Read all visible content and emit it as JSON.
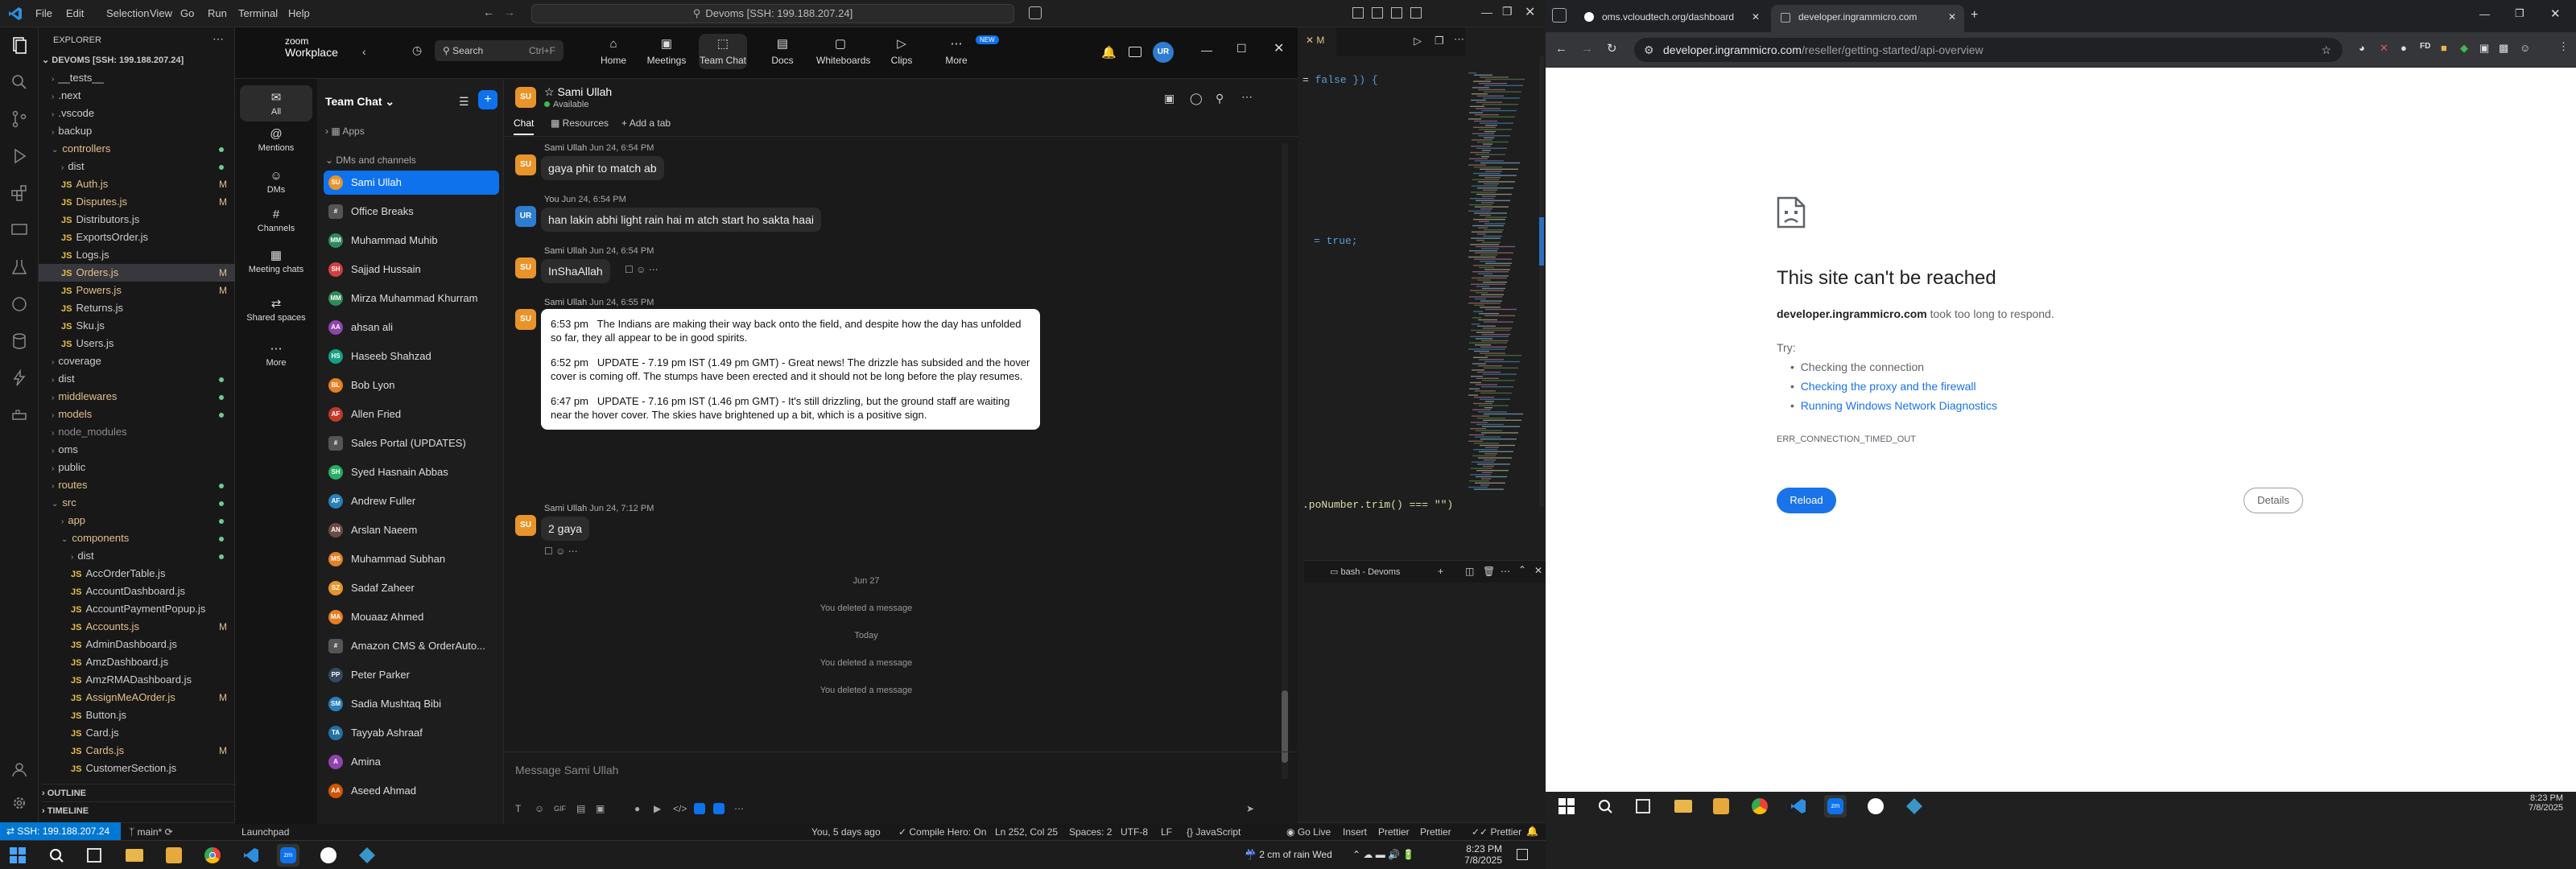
{
  "vscode": {
    "menu": [
      "File",
      "Edit",
      "Selection",
      "View",
      "Go",
      "Run",
      "Terminal",
      "Help"
    ],
    "command_center": "Devoms [SSH: 199.188.207.24]",
    "explorer_title": "EXPLORER",
    "workspace": "DEVOMS [SSH: 199.188.207.24]",
    "tree": [
      {
        "label": "__tests__",
        "kind": "folder",
        "depth": 1
      },
      {
        "label": ".next",
        "kind": "folder",
        "depth": 1
      },
      {
        "label": ".vscode",
        "kind": "folder",
        "depth": 1
      },
      {
        "label": "backup",
        "kind": "folder",
        "depth": 1
      },
      {
        "label": "controllers",
        "kind": "folder-open",
        "depth": 1,
        "color": "#e2c08d",
        "dot": true
      },
      {
        "label": "dist",
        "kind": "folder",
        "depth": 2,
        "dot": true
      },
      {
        "label": "Auth.js",
        "kind": "js",
        "depth": 2,
        "color": "#e2c08d",
        "mark": "M"
      },
      {
        "label": "Disputes.js",
        "kind": "js",
        "depth": 2,
        "color": "#e2c08d",
        "mark": "M"
      },
      {
        "label": "Distributors.js",
        "kind": "js",
        "depth": 2
      },
      {
        "label": "ExportsOrder.js",
        "kind": "js",
        "depth": 2
      },
      {
        "label": "Logs.js",
        "kind": "js",
        "depth": 2
      },
      {
        "label": "Orders.js",
        "kind": "js",
        "depth": 2,
        "color": "#e2c08d",
        "mark": "M",
        "selected": true
      },
      {
        "label": "Powers.js",
        "kind": "js",
        "depth": 2,
        "color": "#e2c08d",
        "mark": "M"
      },
      {
        "label": "Returns.js",
        "kind": "js",
        "depth": 2
      },
      {
        "label": "Sku.js",
        "kind": "js",
        "depth": 2
      },
      {
        "label": "Users.js",
        "kind": "js",
        "depth": 2
      },
      {
        "label": "coverage",
        "kind": "folder",
        "depth": 1
      },
      {
        "label": "dist",
        "kind": "folder",
        "depth": 1,
        "dot": true
      },
      {
        "label": "middlewares",
        "kind": "folder",
        "depth": 1,
        "color": "#e2c08d",
        "dot": true
      },
      {
        "label": "models",
        "kind": "folder",
        "depth": 1,
        "color": "#e2c08d",
        "dot": true
      },
      {
        "label": "node_modules",
        "kind": "folder",
        "depth": 1,
        "color": "#8c8c8c"
      },
      {
        "label": "oms",
        "kind": "folder",
        "depth": 1
      },
      {
        "label": "public",
        "kind": "folder",
        "depth": 1
      },
      {
        "label": "routes",
        "kind": "folder",
        "depth": 1,
        "color": "#e2c08d",
        "dot": true
      },
      {
        "label": "src",
        "kind": "folder-open",
        "depth": 1,
        "color": "#e2c08d",
        "dot": true
      },
      {
        "label": "app",
        "kind": "folder",
        "depth": 2,
        "color": "#e2c08d",
        "dot": true
      },
      {
        "label": "components",
        "kind": "folder-open",
        "depth": 2,
        "color": "#e2c08d",
        "dot": true
      },
      {
        "label": "dist",
        "kind": "folder",
        "depth": 3,
        "dot": true
      },
      {
        "label": "AccOrderTable.js",
        "kind": "js",
        "depth": 3
      },
      {
        "label": "AccountDashboard.js",
        "kind": "js",
        "depth": 3
      },
      {
        "label": "AccountPaymentPopup.js",
        "kind": "js",
        "depth": 3
      },
      {
        "label": "Accounts.js",
        "kind": "js",
        "depth": 3,
        "color": "#e2c08d",
        "mark": "M"
      },
      {
        "label": "AdminDashboard.js",
        "kind": "js",
        "depth": 3
      },
      {
        "label": "AmzDashboard.js",
        "kind": "js",
        "depth": 3
      },
      {
        "label": "AmzRMADashboard.js",
        "kind": "js",
        "depth": 3
      },
      {
        "label": "AssignMeAOrder.js",
        "kind": "js",
        "depth": 3,
        "color": "#e2c08d",
        "mark": "M"
      },
      {
        "label": "Button.js",
        "kind": "js",
        "depth": 3
      },
      {
        "label": "Card.js",
        "kind": "js",
        "depth": 3
      },
      {
        "label": "Cards.js",
        "kind": "js",
        "depth": 3,
        "color": "#e2c08d",
        "mark": "M"
      },
      {
        "label": "CustomerSection.js",
        "kind": "js",
        "depth": 3
      }
    ],
    "outline": "OUTLINE",
    "timeline": "TIMELINE",
    "code_fragments": [
      "false }) {",
      "= true;",
      ".poNumber.trim() === \"\")"
    ],
    "terminal_label": "bash - Devoms",
    "status": {
      "remote": "SSH: 199.188.207.24",
      "branch": "main*",
      "launchpad": "Launchpad",
      "blame": "You, 5 days ago",
      "compile": "Compile Hero: On",
      "position": "Ln 252, Col 25",
      "spaces": "Spaces: 2",
      "encoding": "UTF-8",
      "eol": "LF",
      "lang": "JavaScript",
      "golive": "Go Live",
      "insert": "Insert",
      "prettier1": "Prettier",
      "prettier2": "Prettier",
      "prettier3": "Prettier"
    },
    "taskbar": {
      "weather": "2 cm of rain Wed",
      "time": "8:23 PM",
      "date": "7/8/2025"
    }
  },
  "zoom": {
    "logo_top": "zoom",
    "logo_bottom": "Workplace",
    "search": "Search",
    "shortcut": "Ctrl+F",
    "nav": [
      "Home",
      "Meetings",
      "Team Chat",
      "Docs",
      "Whiteboards",
      "Clips",
      "More"
    ],
    "new_badge": "NEW",
    "user_initials": "UR",
    "side": [
      "All",
      "Mentions",
      "DMs",
      "Channels",
      "Meeting chats",
      "Shared spaces",
      "More"
    ],
    "list_title": "Team Chat",
    "apps": "Apps",
    "dms_header": "DMs and channels",
    "chats": [
      {
        "name": "Sami Ullah",
        "init": "SU",
        "color": "#e8942a",
        "selected": true
      },
      {
        "name": "Office Breaks",
        "init": "#",
        "color": "#555"
      },
      {
        "name": "Muhammad Muhib",
        "init": "MM",
        "color": "#2e8b57"
      },
      {
        "name": "Sajjad Hussain",
        "init": "SH",
        "color": "#d04040"
      },
      {
        "name": "Mirza Muhammad Khurram",
        "init": "MM",
        "color": "#2e8b57"
      },
      {
        "name": "ahsan ali",
        "init": "AA",
        "color": "#8e44ad"
      },
      {
        "name": "Haseeb Shahzad",
        "init": "HS",
        "color": "#16a085"
      },
      {
        "name": "Bob Lyon",
        "init": "BL",
        "color": "#e67e22"
      },
      {
        "name": "Allen Fried",
        "init": "AF",
        "color": "#c0392b"
      },
      {
        "name": "Sales Portal (UPDATES)",
        "init": "#",
        "color": "#555"
      },
      {
        "name": "Syed Hasnain Abbas",
        "init": "SH",
        "color": "#27ae60"
      },
      {
        "name": "Andrew Fuller",
        "init": "AF",
        "color": "#2980b9"
      },
      {
        "name": "Arslan Naeem",
        "init": "AN",
        "color": "#6d4c41"
      },
      {
        "name": "Muhammad Subhan",
        "init": "MS",
        "color": "#e67e22"
      },
      {
        "name": "Sadaf Zaheer",
        "init": "SZ",
        "color": "#e8942a"
      },
      {
        "name": "Mouaaz Ahmed",
        "init": "MA",
        "color": "#e67e22"
      },
      {
        "name": "Amazon CMS & OrderAuto...",
        "init": "#",
        "color": "#555"
      },
      {
        "name": "Peter Parker",
        "init": "PP",
        "color": "#34495e"
      },
      {
        "name": "Sadia Mushtaq Bibi",
        "init": "SM",
        "color": "#2980b9"
      },
      {
        "name": "Tayyab Ashraaf",
        "init": "TA",
        "color": "#2471a3"
      },
      {
        "name": "Amina",
        "init": "A",
        "color": "#8e44ad"
      },
      {
        "name": "Aseed Ahmad",
        "init": "AA",
        "color": "#d35400"
      }
    ],
    "contact": "Sami Ullah",
    "presence": "Available",
    "tabs": [
      "Chat",
      "Resources",
      "Add a tab"
    ],
    "messages": [
      {
        "sender": "Sami Ullah",
        "time": "Jun 24, 6:54 PM",
        "text": "gaya phir to match ab",
        "mine": false
      },
      {
        "sender": "You",
        "time": "Jun 24, 6:54 PM",
        "text": "han lakin abhi light rain hai m atch start ho sakta haai",
        "mine": true
      },
      {
        "sender": "Sami Ullah",
        "time": "Jun 24, 6:54 PM",
        "text": "InShaAllah",
        "mine": false
      },
      {
        "sender": "Sami Ullah",
        "time": "Jun 24, 6:55 PM",
        "mine": false
      }
    ],
    "long_message": [
      {
        "time": "6:53 pm",
        "text": "The Indians are making their way back onto the field, and despite how the day has unfolded so far, they all appear to be in good spirits."
      },
      {
        "time": "6:52 pm",
        "text": "UPDATE - 7.19 pm IST (1.49 pm GMT) - Great news! The drizzle has subsided and the hover cover is coming off. The stumps have been erected and it should not be long before the play resumes."
      },
      {
        "time": "6:47 pm",
        "text": "UPDATE - 7.16 pm IST (1.46 pm GMT) - It's still drizzling, but the ground staff are waiting near the hover cover. The skies have brightened up a bit, which is a positive sign."
      }
    ],
    "last_message": {
      "sender": "Sami Ullah",
      "time": "Jun 24, 7:12 PM",
      "text": "2 gaya"
    },
    "system": [
      "Jun 27",
      "You deleted a message",
      "Today",
      "You deleted a message",
      "You deleted a message"
    ],
    "compose_placeholder": "Message Sami Ullah"
  },
  "browser": {
    "tabs": [
      {
        "title": "oms.vcloudtech.org/dashboard",
        "active": false
      },
      {
        "title": "developer.ingrammicro.com",
        "active": true
      }
    ],
    "url_host": "developer.ingrammicro.com",
    "url_path": "/reseller/getting-started/api-overview",
    "error": {
      "title": "This site can't be reached",
      "host": "developer.ingrammicro.com",
      "reason": "took too long to respond.",
      "try": "Try:",
      "suggestions": [
        "Checking the connection",
        "Checking the proxy and the firewall",
        "Running Windows Network Diagnostics"
      ],
      "code": "ERR_CONNECTION_TIMED_OUT",
      "reload": "Reload",
      "details": "Details"
    },
    "taskbar": {
      "time": "8:23 PM",
      "date": "7/8/2025"
    }
  }
}
